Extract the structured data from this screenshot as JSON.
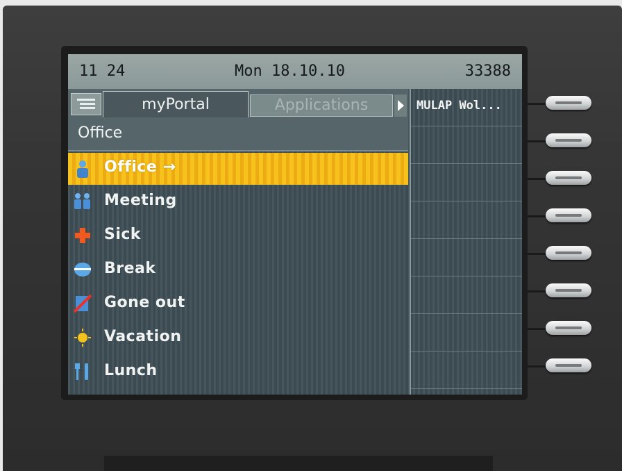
{
  "status_bar": {
    "time": "11 24",
    "date": "Mon 18.10.10",
    "extension": "33388"
  },
  "tabs": [
    {
      "label": "myPortal",
      "active": true
    },
    {
      "label": "Applications",
      "active": false
    }
  ],
  "list_header": "Office",
  "items": [
    {
      "label": "Office →",
      "icon": "person-icon",
      "selected": true
    },
    {
      "label": "Meeting",
      "icon": "meeting-icon",
      "selected": false
    },
    {
      "label": "Sick",
      "icon": "red-cross-icon",
      "selected": false
    },
    {
      "label": "Break",
      "icon": "coffee-cup-icon",
      "selected": false
    },
    {
      "label": "Gone out",
      "icon": "gone-out-icon",
      "selected": false
    },
    {
      "label": "Vacation",
      "icon": "sun-icon",
      "selected": false
    },
    {
      "label": "Lunch",
      "icon": "fork-knife-icon",
      "selected": false
    }
  ],
  "right_column": [
    "MULAP Wol...",
    "",
    "",
    "",
    "",
    "",
    "",
    ""
  ],
  "colors": {
    "selected_bg": "#f6c21b",
    "screen_bg": "#3f4f56",
    "status_bg": "#9aa7a5"
  }
}
